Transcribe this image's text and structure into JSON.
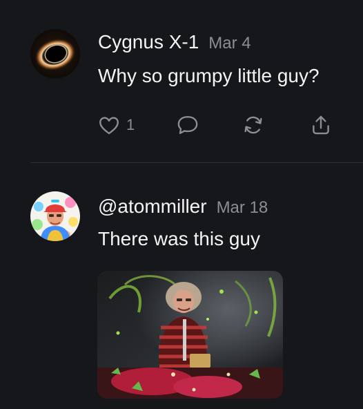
{
  "posts": [
    {
      "author": "Cygnus X-1",
      "date": "Mar 4",
      "text": "Why so grumpy little guy?",
      "like_count": "1",
      "avatar_icon": "black-hole-avatar"
    },
    {
      "author": "@atommiller",
      "date": "Mar 18",
      "text": "There was this guy",
      "avatar_icon": "colorful-portrait-avatar",
      "media_icon": "gallagher-watermelon-photo"
    }
  ],
  "actions": [
    "like-icon",
    "reply-icon",
    "repost-icon",
    "share-icon"
  ],
  "colors": {
    "background": "#16171a",
    "text": "#f4f4f5",
    "muted": "#8b8e96",
    "divider": "#2f3137"
  }
}
